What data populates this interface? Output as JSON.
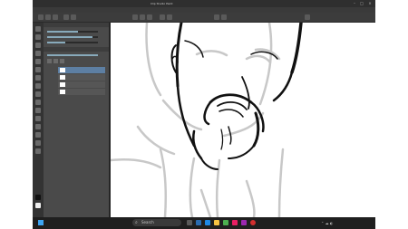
{
  "window": {
    "title": "Clip Studio Paint"
  },
  "menu": [],
  "panel": {
    "header_top": "",
    "header_layers": ""
  },
  "layers": [
    {
      "label": "",
      "selected": true
    },
    {
      "label": "",
      "selected": false
    },
    {
      "label": "",
      "selected": false
    },
    {
      "label": "",
      "selected": false
    }
  ],
  "taskbar": {
    "search_placeholder": "Search",
    "search_icon": "search-icon",
    "time": "",
    "date": ""
  },
  "colors": {
    "accent": "#3da5f4",
    "layer_selected": "#5d7fa3",
    "ui_dark": "#2f2f2f",
    "ui_panel": "#4a4a4a"
  }
}
